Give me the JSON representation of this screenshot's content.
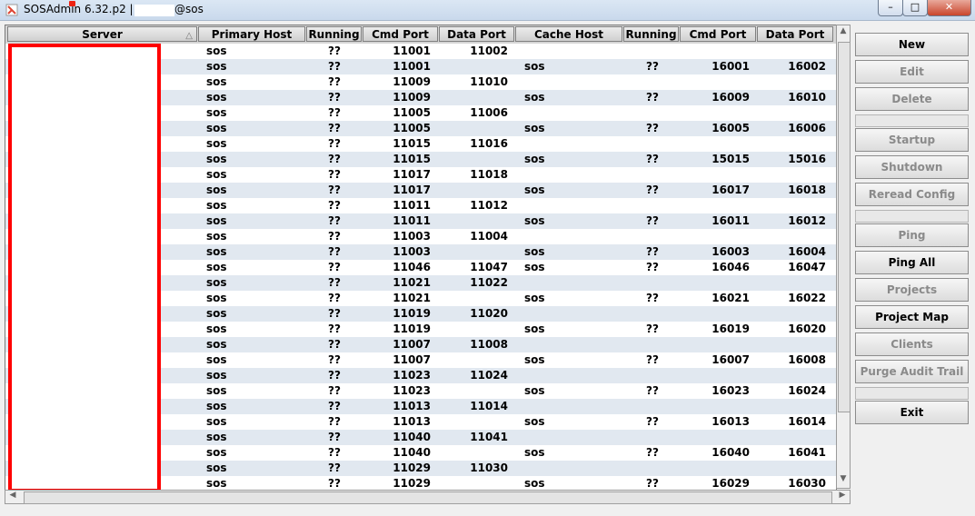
{
  "window": {
    "title": "SOSAdmin 6.32.p2 |",
    "user_suffix": "@sos",
    "minimize": "–",
    "maximize": "□",
    "close": "✕"
  },
  "columns": [
    "Server",
    "Primary Host",
    "Running",
    "Cmd Port",
    "Data Port",
    "Cache Host",
    "Running",
    "Cmd Port",
    "Data Port"
  ],
  "rows": [
    {
      "host": "sos",
      "running": "??",
      "cmd": "11001",
      "data": "11002",
      "chost": "",
      "crun": "",
      "ccmd": "",
      "cdata": ""
    },
    {
      "host": "sos",
      "running": "??",
      "cmd": "11001",
      "data": "",
      "chost": "sos",
      "crun": "??",
      "ccmd": "16001",
      "cdata": "16002"
    },
    {
      "host": "sos",
      "running": "??",
      "cmd": "11009",
      "data": "11010",
      "chost": "",
      "crun": "",
      "ccmd": "",
      "cdata": ""
    },
    {
      "host": "sos",
      "running": "??",
      "cmd": "11009",
      "data": "",
      "chost": "sos",
      "crun": "??",
      "ccmd": "16009",
      "cdata": "16010"
    },
    {
      "host": "sos",
      "running": "??",
      "cmd": "11005",
      "data": "11006",
      "chost": "",
      "crun": "",
      "ccmd": "",
      "cdata": ""
    },
    {
      "host": "sos",
      "running": "??",
      "cmd": "11005",
      "data": "",
      "chost": "sos",
      "crun": "??",
      "ccmd": "16005",
      "cdata": "16006"
    },
    {
      "host": "sos",
      "running": "??",
      "cmd": "11015",
      "data": "11016",
      "chost": "",
      "crun": "",
      "ccmd": "",
      "cdata": ""
    },
    {
      "host": "sos",
      "running": "??",
      "cmd": "11015",
      "data": "",
      "chost": "sos",
      "crun": "??",
      "ccmd": "15015",
      "cdata": "15016"
    },
    {
      "host": "sos",
      "running": "??",
      "cmd": "11017",
      "data": "11018",
      "chost": "",
      "crun": "",
      "ccmd": "",
      "cdata": ""
    },
    {
      "host": "sos",
      "running": "??",
      "cmd": "11017",
      "data": "",
      "chost": "sos",
      "crun": "??",
      "ccmd": "16017",
      "cdata": "16018"
    },
    {
      "host": "sos",
      "running": "??",
      "cmd": "11011",
      "data": "11012",
      "chost": "",
      "crun": "",
      "ccmd": "",
      "cdata": ""
    },
    {
      "host": "sos",
      "running": "??",
      "cmd": "11011",
      "data": "",
      "chost": "sos",
      "crun": "??",
      "ccmd": "16011",
      "cdata": "16012"
    },
    {
      "host": "sos",
      "running": "??",
      "cmd": "11003",
      "data": "11004",
      "chost": "",
      "crun": "",
      "ccmd": "",
      "cdata": ""
    },
    {
      "host": "sos",
      "running": "??",
      "cmd": "11003",
      "data": "",
      "chost": "sos",
      "crun": "??",
      "ccmd": "16003",
      "cdata": "16004"
    },
    {
      "host": "sos",
      "running": "??",
      "cmd": "11046",
      "data": "11047",
      "chost": "sos",
      "crun": "??",
      "ccmd": "16046",
      "cdata": "16047"
    },
    {
      "host": "sos",
      "running": "??",
      "cmd": "11021",
      "data": "11022",
      "chost": "",
      "crun": "",
      "ccmd": "",
      "cdata": ""
    },
    {
      "host": "sos",
      "running": "??",
      "cmd": "11021",
      "data": "",
      "chost": "sos",
      "crun": "??",
      "ccmd": "16021",
      "cdata": "16022"
    },
    {
      "host": "sos",
      "running": "??",
      "cmd": "11019",
      "data": "11020",
      "chost": "",
      "crun": "",
      "ccmd": "",
      "cdata": ""
    },
    {
      "host": "sos",
      "running": "??",
      "cmd": "11019",
      "data": "",
      "chost": "sos",
      "crun": "??",
      "ccmd": "16019",
      "cdata": "16020"
    },
    {
      "host": "sos",
      "running": "??",
      "cmd": "11007",
      "data": "11008",
      "chost": "",
      "crun": "",
      "ccmd": "",
      "cdata": ""
    },
    {
      "host": "sos",
      "running": "??",
      "cmd": "11007",
      "data": "",
      "chost": "sos",
      "crun": "??",
      "ccmd": "16007",
      "cdata": "16008"
    },
    {
      "host": "sos",
      "running": "??",
      "cmd": "11023",
      "data": "11024",
      "chost": "",
      "crun": "",
      "ccmd": "",
      "cdata": ""
    },
    {
      "host": "sos",
      "running": "??",
      "cmd": "11023",
      "data": "",
      "chost": "sos",
      "crun": "??",
      "ccmd": "16023",
      "cdata": "16024"
    },
    {
      "host": "sos",
      "running": "??",
      "cmd": "11013",
      "data": "11014",
      "chost": "",
      "crun": "",
      "ccmd": "",
      "cdata": ""
    },
    {
      "host": "sos",
      "running": "??",
      "cmd": "11013",
      "data": "",
      "chost": "sos",
      "crun": "??",
      "ccmd": "16013",
      "cdata": "16014"
    },
    {
      "host": "sos",
      "running": "??",
      "cmd": "11040",
      "data": "11041",
      "chost": "",
      "crun": "",
      "ccmd": "",
      "cdata": ""
    },
    {
      "host": "sos",
      "running": "??",
      "cmd": "11040",
      "data": "",
      "chost": "sos",
      "crun": "??",
      "ccmd": "16040",
      "cdata": "16041"
    },
    {
      "host": "sos",
      "running": "??",
      "cmd": "11029",
      "data": "11030",
      "chost": "",
      "crun": "",
      "ccmd": "",
      "cdata": ""
    },
    {
      "host": "sos",
      "running": "??",
      "cmd": "11029",
      "data": "",
      "chost": "sos",
      "crun": "??",
      "ccmd": "16029",
      "cdata": "16030"
    }
  ],
  "buttons": {
    "new": "New",
    "edit": "Edit",
    "delete": "Delete",
    "startup": "Startup",
    "shutdown": "Shutdown",
    "reread_config": "Reread Config",
    "ping": "Ping",
    "ping_all": "Ping All",
    "projects": "Projects",
    "project_map": "Project Map",
    "clients": "Clients",
    "purge_audit_trail": "Purge Audit Trail",
    "exit": "Exit"
  },
  "icons": {
    "app": "sosadmin-app-icon",
    "sort": "sort-ascending-icon"
  },
  "colors": {
    "row_alt": "#e1e8f0",
    "highlight_box": "#ff0000",
    "disabled_text": "#8a8a8a"
  }
}
